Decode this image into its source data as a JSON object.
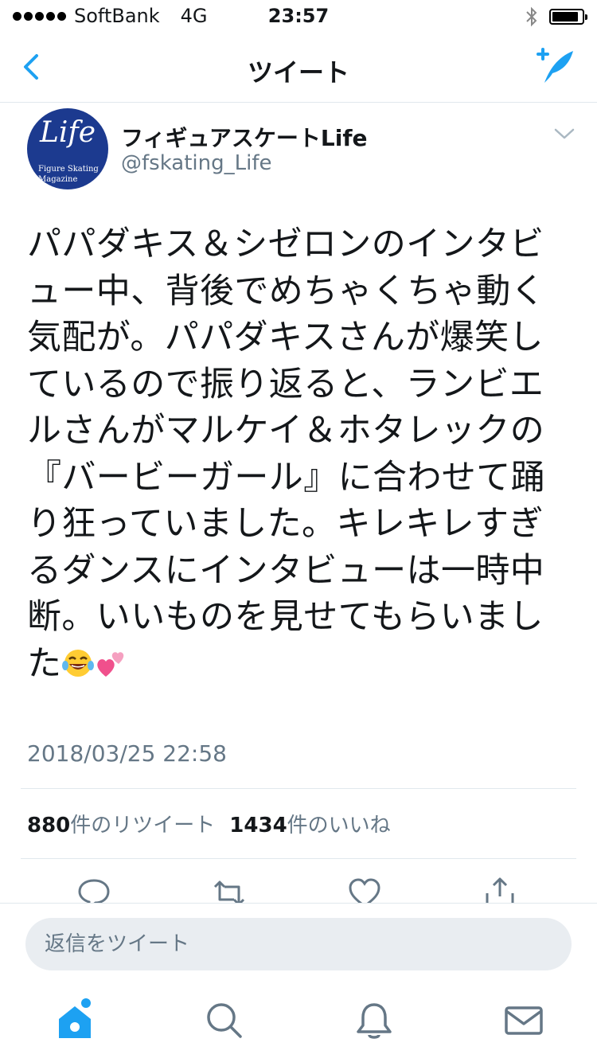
{
  "status_bar": {
    "carrier": "SoftBank",
    "network": "4G",
    "time": "23:57",
    "battery_level": 0.9
  },
  "nav": {
    "title": "ツイート"
  },
  "author": {
    "display_name": "フィギュアスケートLife",
    "handle": "@fskating_Life",
    "avatar_brand": "Life",
    "avatar_sub": "Figure Skating\nMagazine"
  },
  "tweet": {
    "text": "パパダキス＆シゼロンのインタビュー中、背後でめちゃくちゃ動く気配が。パパダキスさんが爆笑しているので振り返ると、ランビエルさんがマルケイ＆ホタレックの『バービーガール』に合わせて踊り狂っていました。キレキレすぎるダンスにインタビューは一時中断。いいものを見せてもらいました",
    "emojis": [
      "laughing-tears-emoji",
      "two-hearts-emoji"
    ],
    "timestamp": "2018/03/25 22:58",
    "retweets_count": "880",
    "retweets_label": "件のリツイート",
    "likes_count": "1434",
    "likes_label": "件のいいね"
  },
  "actions": [
    "reply-icon",
    "retweet-icon",
    "like-icon",
    "share-icon"
  ],
  "reply": {
    "placeholder": "返信をツイート"
  },
  "tabs": [
    "home-icon",
    "search-icon",
    "notifications-icon",
    "messages-icon"
  ],
  "colors": {
    "accent": "#1da1f2",
    "text": "#14171a",
    "secondary": "#657786",
    "divider": "#e1e8ed",
    "avatar_bg": "#1c3a8f"
  }
}
